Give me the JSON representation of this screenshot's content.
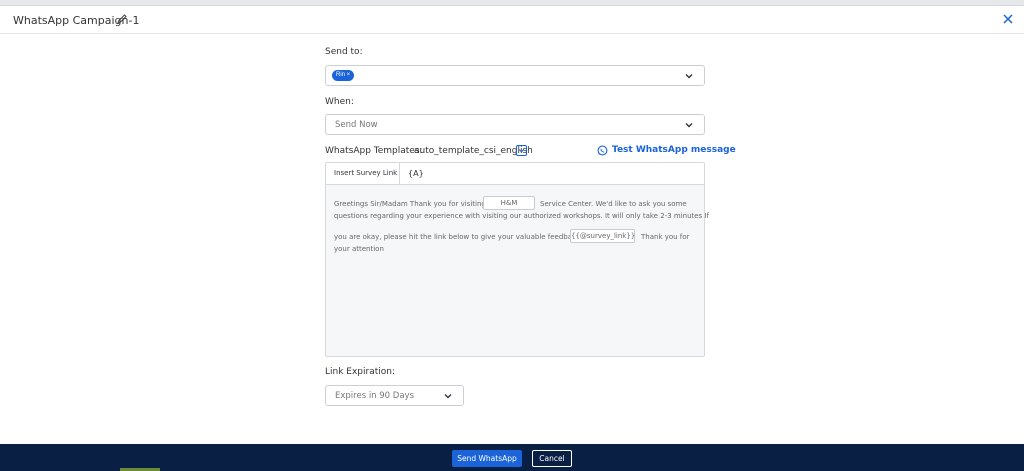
{
  "header": {
    "title": "WhatsApp Campaign-1"
  },
  "send_to": {
    "label": "Send to:",
    "chip": "Rin ×"
  },
  "when": {
    "label": "When:",
    "value": "Send Now"
  },
  "templates": {
    "label": "WhatsApp Templates:",
    "value": "auto_template_csi_english",
    "test_link": "Test WhatsApp message"
  },
  "editor": {
    "insert_survey_link": "Insert Survey Link",
    "field_button": "{A}",
    "line1_a": "Greetings Sir/Madam Thank you for visiting",
    "field1": "H&M",
    "line1_b": "Service Center. We'd like to ask you some",
    "line2": "questions regarding your experience with visiting our authorized workshops. It will only take 2-3 minutes If",
    "line3_a": "you are okay, please hit the link below to give your valuable feedback:",
    "field2": "{{@survey_link}}",
    "line3_b": "Thank you for",
    "line4": "your attention"
  },
  "link_expiration": {
    "label": "Link Expiration:",
    "value": "Expires in 90 Days"
  },
  "footer": {
    "send_label": "Send WhatsApp",
    "cancel_label": "Cancel"
  },
  "icons": {
    "edit": "pencil-icon",
    "close": "close-icon",
    "chevron": "chevron-down-icon",
    "whatsapp": "whatsapp-icon"
  },
  "colors": {
    "accent": "#1a63d8",
    "footer": "#0a1f44"
  }
}
